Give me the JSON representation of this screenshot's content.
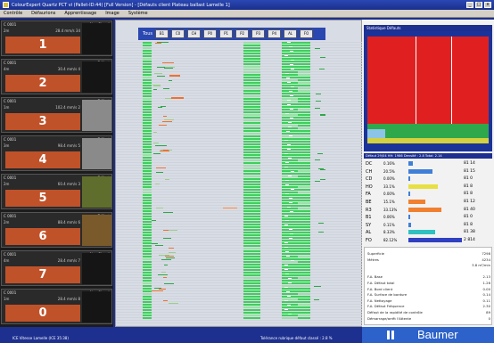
{
  "window": {
    "title": "ColourExpert Quartz PCT vi (Pallet-ID:44) [Full Version] - [Défauts client Plateau ballast Lamelle 1]",
    "min_label": "_",
    "max_label": "□",
    "close_label": "x"
  },
  "menu": [
    "Contrôle",
    "Défaurions",
    "Apprentissage",
    "Image",
    "Système"
  ],
  "cameras": [
    {
      "id": "C 0001",
      "status": "Non Classé",
      "sub1": "2m",
      "sub2": "28.4 mm/s 34",
      "number": "1",
      "thumb": "dark"
    },
    {
      "id": "C 0001",
      "status": "Défaut",
      "sub1": "4m",
      "sub2": "30.4 mm/s 4",
      "number": "2",
      "thumb": "dark"
    },
    {
      "id": "C 0001",
      "status": "Défaut",
      "sub1": "1m",
      "sub2": "102.4 mm/s 2",
      "number": "3",
      "thumb": "gray"
    },
    {
      "id": "C 0001",
      "status": "Défaut",
      "sub1": "3m",
      "sub2": "98.4 mm/s 5",
      "number": "4",
      "thumb": "gray"
    },
    {
      "id": "C 0001",
      "status": "Défaut",
      "sub1": "2m",
      "sub2": "60.4 mm/s 3",
      "number": "5",
      "thumb": "green"
    },
    {
      "id": "C 0001",
      "status": "Défaut",
      "sub1": "2m",
      "sub2": "88.4 mm/s 6",
      "number": "6",
      "thumb": "brown"
    },
    {
      "id": "C 0001",
      "status": "Non Classé",
      "sub1": "4m",
      "sub2": "28.4 mm/s 7",
      "number": "7",
      "thumb": "dark"
    },
    {
      "id": "C 0001",
      "status": "Non Classé",
      "sub1": "1m",
      "sub2": "28.4 mm/s 8",
      "number": "0",
      "thumb": "dark"
    }
  ],
  "tabs": {
    "label": "Tous",
    "items": [
      "B1",
      "C0",
      "CH",
      "P0",
      "P1",
      "P2",
      "P3",
      "P4",
      "AL",
      "FO"
    ]
  },
  "right_header": "Statistique Défauts",
  "right_status": "Défaut 29/04 HH: 1986 Densité : 2.8 Total: 2.14",
  "defects": [
    {
      "code": "DC",
      "pct": "0.16%",
      "count": "81",
      "cnt2": "14",
      "color": "#3f7fd8",
      "level": 0.08
    },
    {
      "code": "CH",
      "pct": "20.5%",
      "count": "81",
      "cnt2": "15",
      "color": "#3f7fd8",
      "level": 0.45
    },
    {
      "code": "CD",
      "pct": "0.00%",
      "count": "81",
      "cnt2": "0",
      "color": "#3f7fd8",
      "level": 0.02
    },
    {
      "code": "HO",
      "pct": "33.1%",
      "count": "81",
      "cnt2": "8",
      "color": "#e8e040",
      "level": 0.55
    },
    {
      "code": "FA",
      "pct": "0.00%",
      "count": "81",
      "cnt2": "8",
      "color": "#3f7fd8",
      "level": 0.02
    },
    {
      "code": "BE",
      "pct": "15.1%",
      "count": "81",
      "cnt2": "12",
      "color": "#f08030",
      "level": 0.32
    },
    {
      "code": "R3",
      "pct": "33.13%",
      "count": "81",
      "cnt2": "40",
      "color": "#f08030",
      "level": 0.62
    },
    {
      "code": "B1",
      "pct": "0.06%",
      "count": "81",
      "cnt2": "0",
      "color": "#3f7fd8",
      "level": 0.03
    },
    {
      "code": "SY",
      "pct": "0.11%",
      "count": "81",
      "cnt2": "8",
      "color": "#3f7fd8",
      "level": 0.05
    },
    {
      "code": "AL",
      "pct": "8.33%",
      "count": "81",
      "cnt2": "38",
      "color": "#30c0c0",
      "level": 0.5
    },
    {
      "code": "FO",
      "pct": "82.12%",
      "count": "2",
      "cnt2": "814",
      "color": "#3040c0",
      "level": 1.0
    }
  ],
  "stats": [
    {
      "label": "Superficie",
      "value": "7298"
    },
    {
      "label": "Mètres",
      "value": "4234"
    },
    {
      "label": "",
      "value": "3.8 m²/min"
    },
    {
      "label": "",
      "value": ""
    },
    {
      "label": "F.A. Base",
      "value": "2.13"
    },
    {
      "label": "F.A. Défaut total",
      "value": "1.26"
    },
    {
      "label": "F.A. Bord client",
      "value": "0.00"
    },
    {
      "label": "F.A. Surface de bordure",
      "value": "0.14"
    },
    {
      "label": "F.A. Nettoyage",
      "value": "0.11"
    },
    {
      "label": "F.A. Défaut Fréquence",
      "value": "2.30"
    },
    {
      "label": "Défaut de la rapidité de contrôle",
      "value": "89"
    },
    {
      "label": "Démarrage/arrêt l'Attente",
      "value": "0"
    }
  ],
  "statusbar": {
    "left": "ICE Vitesse Lamelle (ICE 35:38)",
    "middle": "Tolérance rubrique défaut classé : 2.8 %"
  },
  "brand": "Baumer"
}
